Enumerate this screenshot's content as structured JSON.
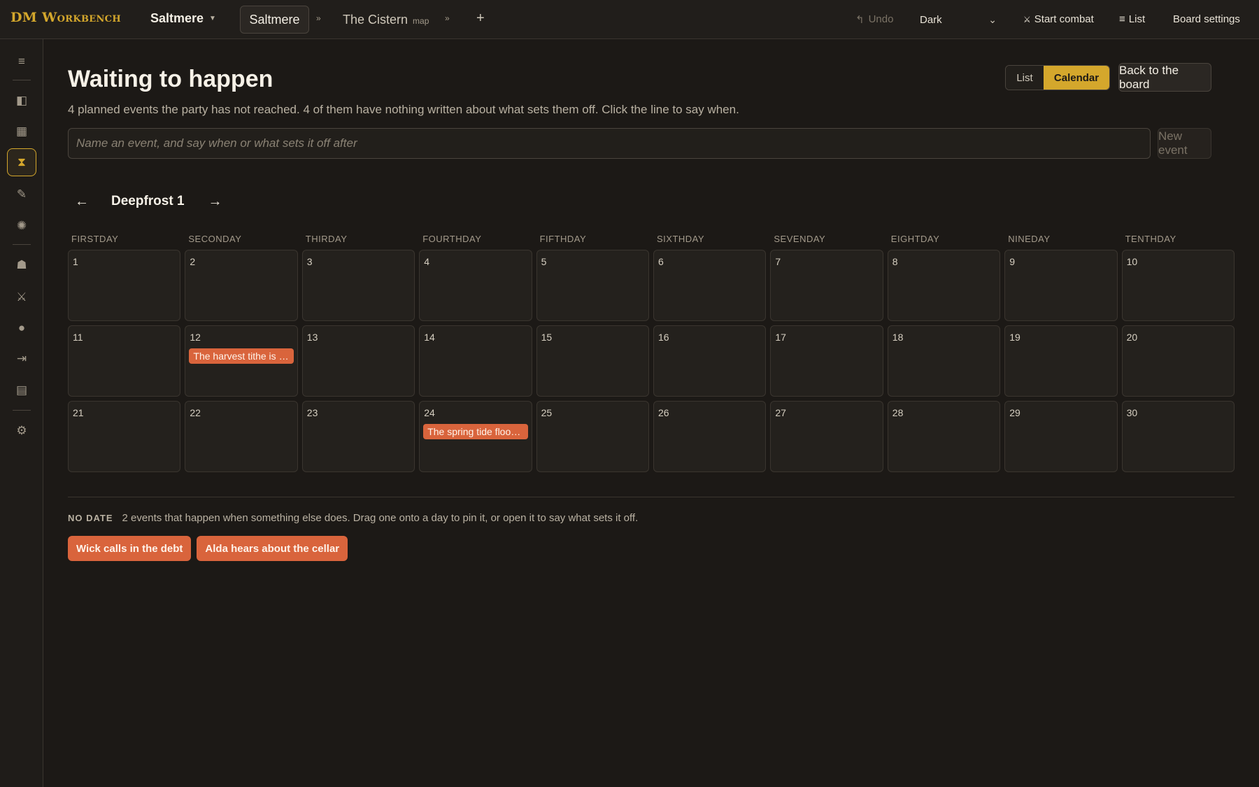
{
  "app": {
    "brand": "DM Workbench"
  },
  "header": {
    "campaign": "Saltmere",
    "tabs": [
      {
        "label": "Saltmere",
        "sub": ""
      },
      {
        "label": "The Cistern",
        "sub": "map"
      }
    ],
    "tab_chevron": "»",
    "add_tab": "+",
    "undo": {
      "icon": "↰",
      "label": "Undo"
    },
    "theme": "Dark",
    "start_combat": {
      "icon": "⚔",
      "label": "Start combat"
    },
    "list": {
      "icon": "≡",
      "label": "List"
    },
    "board_settings": "Board settings"
  },
  "sidebar": {
    "icons": [
      "menu-icon",
      "panel-icon",
      "grid-icon",
      "hourglass-icon",
      "pencil-icon",
      "sun-icon",
      "bell-icon",
      "swords-icon",
      "dot-icon",
      "export-icon",
      "layers-icon",
      "gear-icon"
    ],
    "glyphs": [
      "≡",
      "◧",
      "▦",
      "⧗",
      "✎",
      "✺",
      "☗",
      "⚔",
      "●",
      "⇥",
      "▤",
      "⚙"
    ],
    "active": "hourglass-icon"
  },
  "main": {
    "title": "Waiting to happen",
    "subtitle": "4 planned events the party has not reached. 4 of them have nothing written about what sets them off. Click the line to say when.",
    "view_toggle": {
      "list": "List",
      "calendar": "Calendar",
      "selected": "calendar"
    },
    "back_button": "Back to the board",
    "input_placeholder": "Name an event, and say when or what sets it off after",
    "new_event_button": "New event"
  },
  "calendar": {
    "prev": "←",
    "next": "→",
    "month_label": "Deepfrost 1",
    "weekdays": [
      "FIRSTDAY",
      "SECONDAY",
      "THIRDAY",
      "FOURTHDAY",
      "FIFTHDAY",
      "SIXTHDAY",
      "SEVENDAY",
      "EIGHTDAY",
      "NINEDAY",
      "TENTHDAY"
    ],
    "weeks": [
      [
        {
          "day": "1"
        },
        {
          "day": "2"
        },
        {
          "day": "3"
        },
        {
          "day": "4"
        },
        {
          "day": "5"
        },
        {
          "day": "6"
        },
        {
          "day": "7"
        },
        {
          "day": "8"
        },
        {
          "day": "9"
        },
        {
          "day": "10"
        }
      ],
      [
        {
          "day": "11"
        },
        {
          "day": "12",
          "event": "The harvest tithe is due"
        },
        {
          "day": "13"
        },
        {
          "day": "14"
        },
        {
          "day": "15"
        },
        {
          "day": "16"
        },
        {
          "day": "17"
        },
        {
          "day": "18"
        },
        {
          "day": "19"
        },
        {
          "day": "20"
        }
      ],
      [
        {
          "day": "21"
        },
        {
          "day": "22"
        },
        {
          "day": "23"
        },
        {
          "day": "24",
          "event": "The spring tide floods the cistern"
        },
        {
          "day": "25"
        },
        {
          "day": "26"
        },
        {
          "day": "27"
        },
        {
          "day": "28"
        },
        {
          "day": "29"
        },
        {
          "day": "30"
        }
      ]
    ],
    "event_color": "#d9643c"
  },
  "no_date": {
    "label": "NO DATE",
    "description": "2 events that happen when something else does. Drag one onto a day to pin it, or open it to say what sets it off.",
    "events": [
      "Wick calls in the debt",
      "Alda hears about the cellar"
    ]
  },
  "colors": {
    "accent": "#d4a72c",
    "background": "#1c1916"
  }
}
